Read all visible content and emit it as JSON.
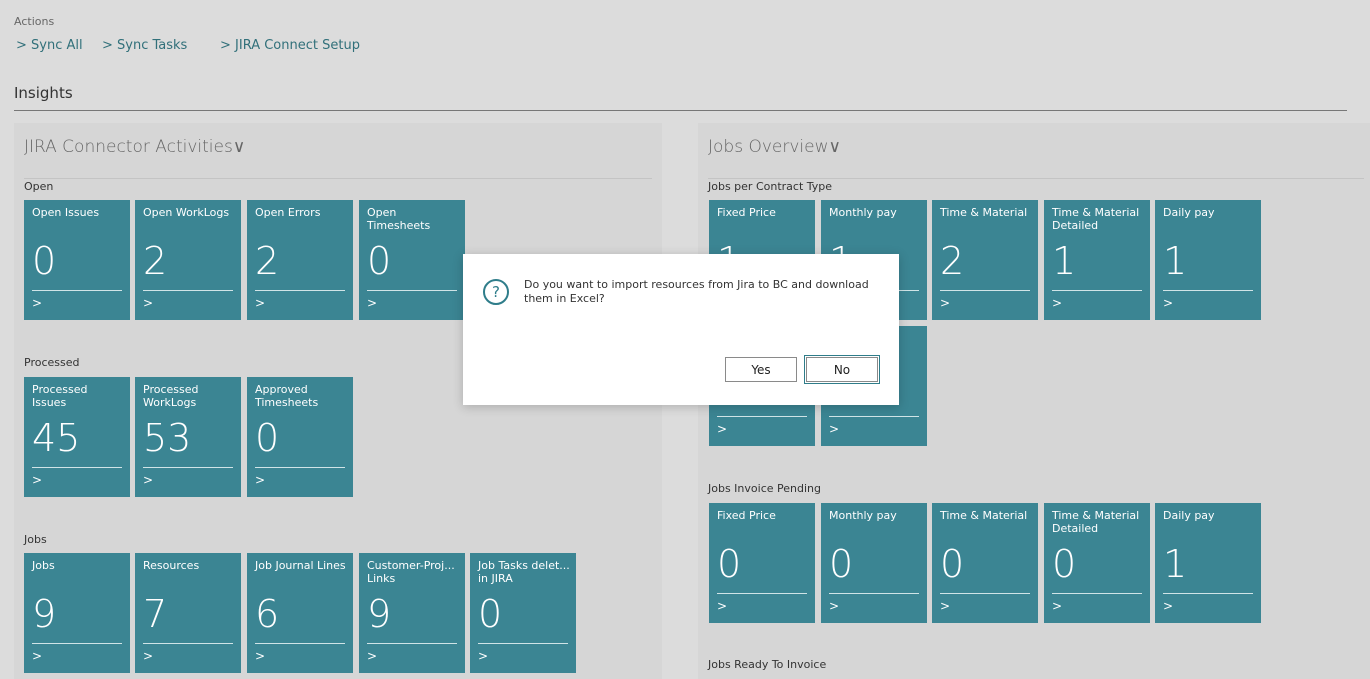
{
  "actions": {
    "label": "Actions",
    "links": [
      "> Sync All",
      "> Sync Tasks",
      "> JIRA Connect Setup"
    ]
  },
  "insights_title": "Insights",
  "left_panel": {
    "title": "JIRA Connector Activities∨",
    "groups": [
      {
        "label": "Open",
        "tiles": [
          {
            "label": "Open Issues",
            "value": "0",
            "arrow": ">"
          },
          {
            "label": "Open WorkLogs",
            "value": "2",
            "arrow": ">"
          },
          {
            "label": "Open Errors",
            "value": "2",
            "arrow": ">"
          },
          {
            "label": "Open Timesheets",
            "value": "0",
            "arrow": ">"
          }
        ]
      },
      {
        "label": "Processed",
        "tiles": [
          {
            "label": "Processed Issues",
            "value": "45",
            "arrow": ">"
          },
          {
            "label": "Processed WorkLogs",
            "value": "53",
            "arrow": ">"
          },
          {
            "label": "Approved Timesheets",
            "value": "0",
            "arrow": ">"
          }
        ]
      },
      {
        "label": "Jobs",
        "tiles": [
          {
            "label": "Jobs",
            "value": "9",
            "arrow": ">"
          },
          {
            "label": "Resources",
            "value": "7",
            "arrow": ">"
          },
          {
            "label": "Job Journal Lines",
            "value": "6",
            "arrow": ">"
          },
          {
            "label": "Customer-Proj... Links",
            "value": "9",
            "arrow": ">"
          },
          {
            "label": "Job Tasks delet... in JIRA",
            "value": "0",
            "arrow": ">"
          }
        ]
      }
    ]
  },
  "right_panel": {
    "title": "Jobs Overview∨",
    "groups": [
      {
        "label": "Jobs per Contract Type",
        "tiles": [
          {
            "label": "Fixed Price",
            "value": "1",
            "arrow": ">"
          },
          {
            "label": "Monthly pay",
            "value": "1",
            "arrow": ">"
          },
          {
            "label": "Time & Material",
            "value": "2",
            "arrow": ">"
          },
          {
            "label": "Time & Material Detailed",
            "value": "1",
            "arrow": ">"
          },
          {
            "label": "Daily pay",
            "value": "1",
            "arrow": ">"
          },
          {
            "label": "",
            "value": "",
            "arrow": ">"
          },
          {
            "label": "",
            "value": "",
            "arrow": ">"
          }
        ]
      },
      {
        "label": "Jobs Invoice Pending",
        "tiles": [
          {
            "label": "Fixed Price",
            "value": "0",
            "arrow": ">"
          },
          {
            "label": "Monthly pay",
            "value": "0",
            "arrow": ">"
          },
          {
            "label": "Time & Material",
            "value": "0",
            "arrow": ">"
          },
          {
            "label": "Time & Material Detailed",
            "value": "0",
            "arrow": ">"
          },
          {
            "label": "Daily pay",
            "value": "1",
            "arrow": ">"
          }
        ]
      },
      {
        "label": "Jobs Ready To Invoice",
        "tiles": []
      }
    ]
  },
  "dialog": {
    "icon": "question-icon",
    "message": "Do you want to import resources from Jira to BC and download them in Excel?",
    "yes_label": "Yes",
    "no_label": "No"
  },
  "colors": {
    "tile": "#3b8593",
    "accent": "#2f7d8a",
    "background": "#dcdcdc"
  }
}
